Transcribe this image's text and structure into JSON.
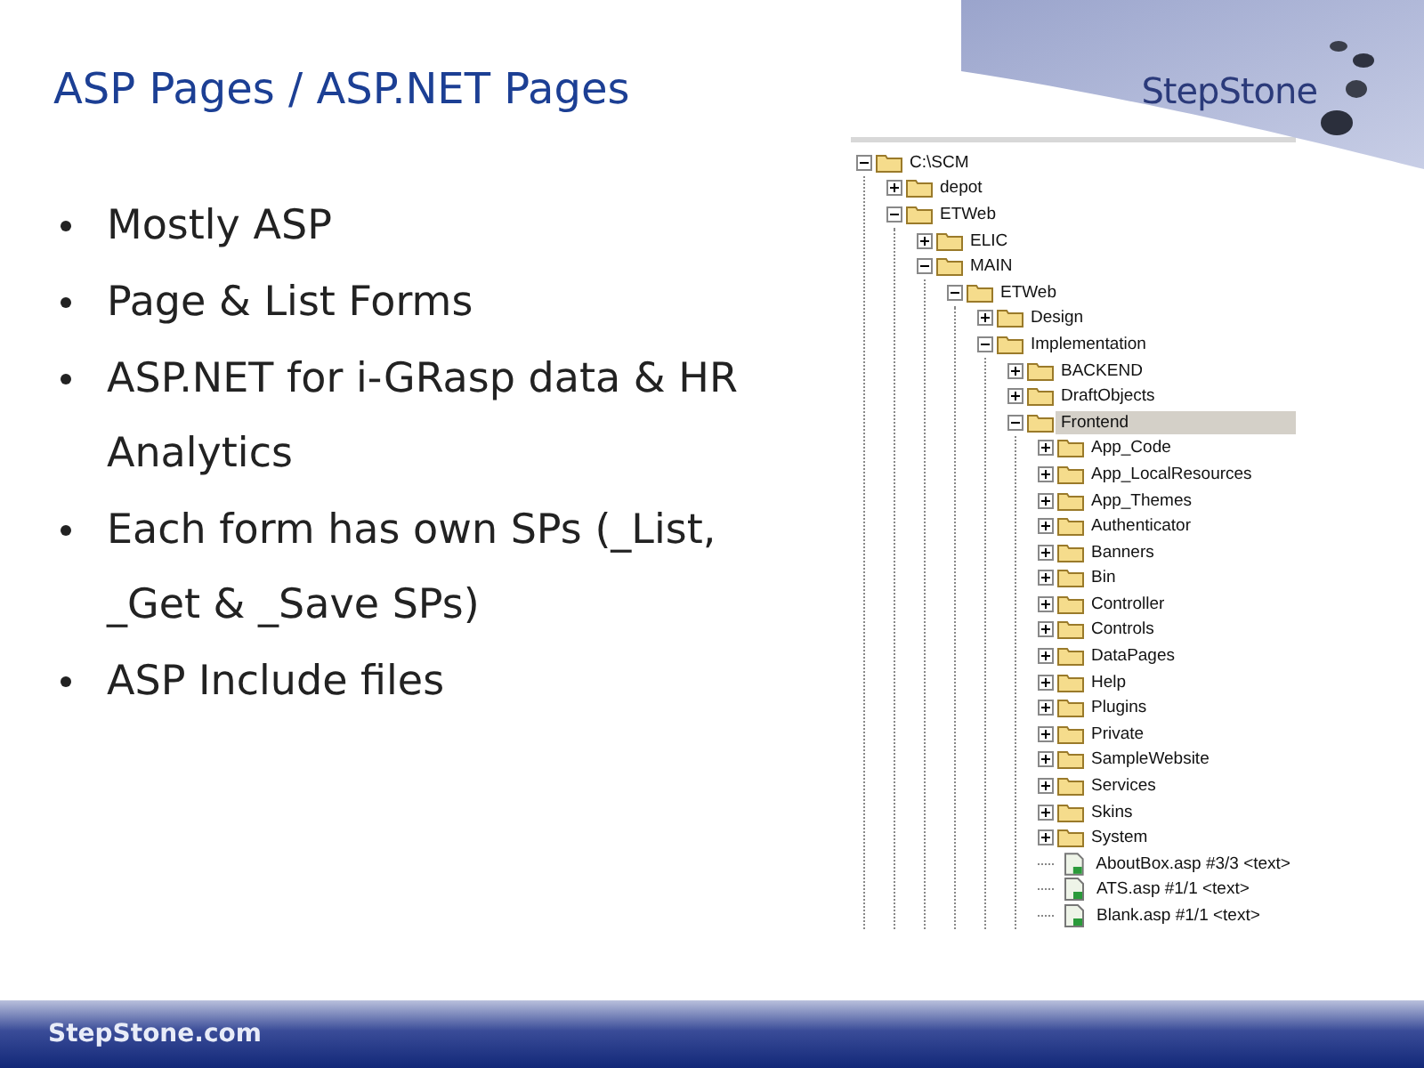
{
  "logo": {
    "text": "StepStone"
  },
  "title": "ASP Pages / ASP.NET Pages",
  "bullets": [
    "Mostly ASP",
    "Page & List Forms",
    "ASP.NET for i-GRasp data & HR Analytics",
    "Each form has own SPs (_List, _Get & _Save SPs)",
    "ASP Include files"
  ],
  "tree": [
    {
      "kind": "folder",
      "label": "C:\\SCM",
      "expanded": true,
      "selected": false,
      "children": [
        {
          "kind": "folder",
          "label": "depot",
          "expanded": false,
          "selected": false
        },
        {
          "kind": "folder",
          "label": "ETWeb",
          "expanded": true,
          "selected": false,
          "children": [
            {
              "kind": "folder",
              "label": "ELIC",
              "expanded": false,
              "selected": false
            },
            {
              "kind": "folder",
              "label": "MAIN",
              "expanded": true,
              "selected": false,
              "children": [
                {
                  "kind": "folder",
                  "label": "ETWeb",
                  "expanded": true,
                  "selected": false,
                  "children": [
                    {
                      "kind": "folder",
                      "label": "Design",
                      "expanded": false,
                      "selected": false
                    },
                    {
                      "kind": "folder",
                      "label": "Implementation",
                      "expanded": true,
                      "selected": false,
                      "children": [
                        {
                          "kind": "folder",
                          "label": "BACKEND",
                          "expanded": false,
                          "selected": false
                        },
                        {
                          "kind": "folder",
                          "label": "DraftObjects",
                          "expanded": false,
                          "selected": false
                        },
                        {
                          "kind": "folder",
                          "label": "Frontend",
                          "expanded": true,
                          "selected": true,
                          "children": [
                            {
                              "kind": "folder",
                              "label": "App_Code",
                              "expanded": false,
                              "selected": false
                            },
                            {
                              "kind": "folder",
                              "label": "App_LocalResources",
                              "expanded": false,
                              "selected": false
                            },
                            {
                              "kind": "folder",
                              "label": "App_Themes",
                              "expanded": false,
                              "selected": false
                            },
                            {
                              "kind": "folder",
                              "label": "Authenticator",
                              "expanded": false,
                              "selected": false
                            },
                            {
                              "kind": "folder",
                              "label": "Banners",
                              "expanded": false,
                              "selected": false
                            },
                            {
                              "kind": "folder",
                              "label": "Bin",
                              "expanded": false,
                              "selected": false
                            },
                            {
                              "kind": "folder",
                              "label": "Controller",
                              "expanded": false,
                              "selected": false
                            },
                            {
                              "kind": "folder",
                              "label": "Controls",
                              "expanded": false,
                              "selected": false
                            },
                            {
                              "kind": "folder",
                              "label": "DataPages",
                              "expanded": false,
                              "selected": false
                            },
                            {
                              "kind": "folder",
                              "label": "Help",
                              "expanded": false,
                              "selected": false
                            },
                            {
                              "kind": "folder",
                              "label": "Plugins",
                              "expanded": false,
                              "selected": false
                            },
                            {
                              "kind": "folder",
                              "label": "Private",
                              "expanded": false,
                              "selected": false
                            },
                            {
                              "kind": "folder",
                              "label": "SampleWebsite",
                              "expanded": false,
                              "selected": false
                            },
                            {
                              "kind": "folder",
                              "label": "Services",
                              "expanded": false,
                              "selected": false
                            },
                            {
                              "kind": "folder",
                              "label": "Skins",
                              "expanded": false,
                              "selected": false
                            },
                            {
                              "kind": "folder",
                              "label": "System",
                              "expanded": false,
                              "selected": false
                            },
                            {
                              "kind": "file",
                              "label": "AboutBox.asp #3/3 <text>",
                              "selected": false
                            },
                            {
                              "kind": "file",
                              "label": "ATS.asp #1/1 <text>",
                              "selected": false
                            },
                            {
                              "kind": "file",
                              "label": "Blank.asp #1/1 <text>",
                              "selected": false
                            }
                          ]
                        }
                      ]
                    }
                  ]
                }
              ]
            }
          ]
        }
      ]
    }
  ],
  "footer": "StepStone.com"
}
